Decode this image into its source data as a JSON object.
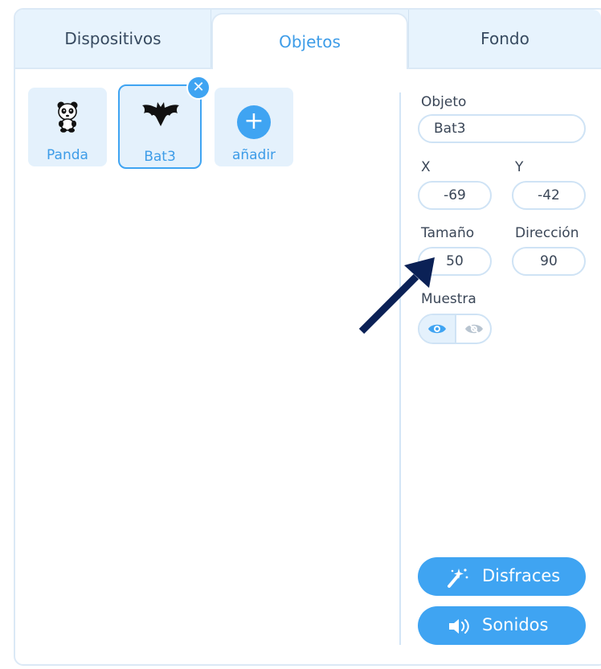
{
  "tabs": [
    {
      "label": "Dispositivos"
    },
    {
      "label": "Objetos"
    },
    {
      "label": "Fondo"
    }
  ],
  "sprites": [
    {
      "name": "Panda",
      "icon": "panda-icon"
    },
    {
      "name": "Bat3",
      "icon": "bat-icon"
    },
    {
      "name": "añadir",
      "icon": "plus-icon"
    }
  ],
  "props": {
    "object_label": "Objeto",
    "object_value": "Bat3",
    "x_label": "X",
    "x_value": "-69",
    "y_label": "Y",
    "y_value": "-42",
    "size_label": "Tamaño",
    "size_value": "50",
    "direction_label": "Dirección",
    "direction_value": "90",
    "show_label": "Muestra"
  },
  "buttons": {
    "costumes": "Disfraces",
    "sounds": "Sonidos"
  },
  "colors": {
    "accent": "#3fa4f2",
    "tab_active_text": "#3d9ce8",
    "arrow": "#0b2156"
  }
}
